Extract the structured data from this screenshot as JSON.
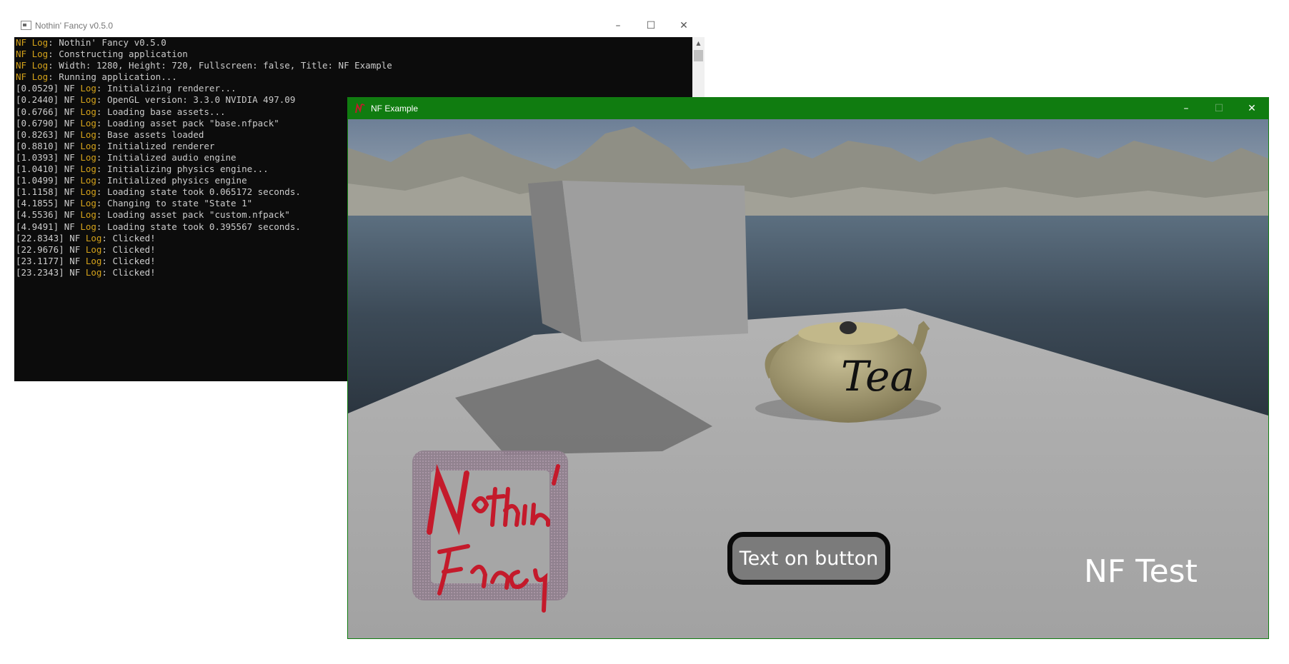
{
  "console": {
    "title": "Nothin' Fancy v0.5.0",
    "controls": {
      "minimize": "–",
      "maximize": "☐",
      "close": "✕"
    },
    "log": [
      {
        "prefix": "",
        "tag": "NF Log",
        "message": ": Nothin' Fancy v0.5.0"
      },
      {
        "prefix": "",
        "tag": "NF Log",
        "message": ": Constructing application"
      },
      {
        "prefix": "",
        "tag": "NF Log",
        "message": ": Width: 1280, Height: 720, Fullscreen: false, Title: NF Example"
      },
      {
        "prefix": "",
        "tag": "NF Log",
        "message": ": Running application..."
      },
      {
        "prefix": "[0.0529] NF ",
        "tag": "Log",
        "message": ": Initializing renderer..."
      },
      {
        "prefix": "[0.2440] NF ",
        "tag": "Log",
        "message": ": OpenGL version: 3.3.0 NVIDIA 497.09"
      },
      {
        "prefix": "[0.6766] NF ",
        "tag": "Log",
        "message": ": Loading base assets..."
      },
      {
        "prefix": "[0.6790] NF ",
        "tag": "Log",
        "message": ": Loading asset pack \"base.nfpack\""
      },
      {
        "prefix": "[0.8263] NF ",
        "tag": "Log",
        "message": ": Base assets loaded"
      },
      {
        "prefix": "[0.8810] NF ",
        "tag": "Log",
        "message": ": Initialized renderer"
      },
      {
        "prefix": "[1.0393] NF ",
        "tag": "Log",
        "message": ": Initialized audio engine"
      },
      {
        "prefix": "[1.0410] NF ",
        "tag": "Log",
        "message": ": Initializing physics engine..."
      },
      {
        "prefix": "[1.0499] NF ",
        "tag": "Log",
        "message": ": Initialized physics engine"
      },
      {
        "prefix": "[1.1158] NF ",
        "tag": "Log",
        "message": ": Loading state took 0.065172 seconds."
      },
      {
        "prefix": "[4.1855] NF ",
        "tag": "Log",
        "message": ": Changing to state \"State 1\""
      },
      {
        "prefix": "[4.5536] NF ",
        "tag": "Log",
        "message": ": Loading asset pack \"custom.nfpack\""
      },
      {
        "prefix": "[4.9491] NF ",
        "tag": "Log",
        "message": ": Loading state took 0.395567 seconds."
      },
      {
        "prefix": "[22.8343] NF ",
        "tag": "Log",
        "message": ": Clicked!"
      },
      {
        "prefix": "[22.9676] NF ",
        "tag": "Log",
        "message": ": Clicked!"
      },
      {
        "prefix": "[23.1177] NF ",
        "tag": "Log",
        "message": ": Clicked!"
      },
      {
        "prefix": "[23.2343] NF ",
        "tag": "Log",
        "message": ": Clicked!"
      }
    ],
    "scroll_up": "▲"
  },
  "game": {
    "title": "NF Example",
    "controls": {
      "minimize": "–",
      "maximize": "☐",
      "close": "✕"
    },
    "teapot_text": "Tea",
    "logo": {
      "line1": "Nothin'",
      "line2": "Fancy"
    },
    "button_label": "Text on button",
    "overlay_text": "NF Test"
  },
  "colors": {
    "title_bar_green": "#107c10",
    "console_bg": "#0c0c0c",
    "console_text": "#cccccc",
    "log_tag": "#d4a21a",
    "floor": "#a6a6a6",
    "cube": "#9e9e9e",
    "teapot": "#a89f72",
    "logo_red": "#c41a2b",
    "logo_frame": "#8b6f86"
  }
}
